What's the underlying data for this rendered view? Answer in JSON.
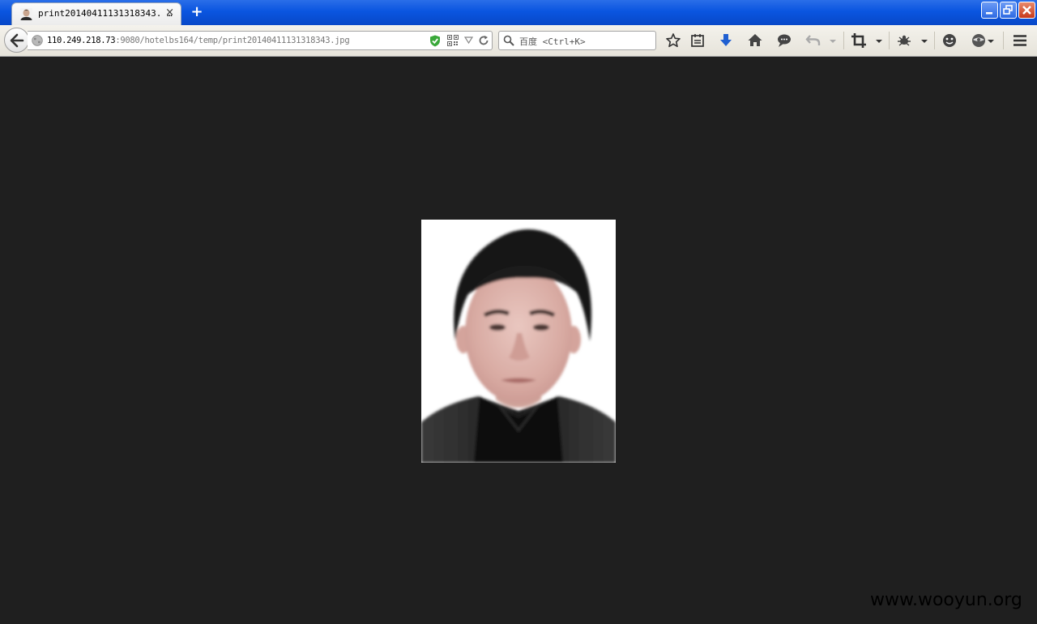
{
  "window": {
    "tab_title": "print20140411131318343. …",
    "new_tab_symbol": "+",
    "tab_close_symbol": "×"
  },
  "address": {
    "url_host": "110.249.218.73",
    "url_rest": ":9080/hotelbs164/temp/print20140411131318343.jpg"
  },
  "search": {
    "placeholder": "百度 <Ctrl+K>"
  },
  "toolbar_icons": [
    "bookmark-star-icon",
    "reading-list-icon",
    "download-icon",
    "home-icon",
    "chat-icon",
    "undo-icon",
    "crop-icon",
    "bug-icon",
    "smiley-icon",
    "addon-icon",
    "menu-icon"
  ],
  "watermark": "www.wooyun.org",
  "colors": {
    "page_background": "#1f1f1f",
    "titlebar": "#0a55e0",
    "download_arrow": "#1f5fd1",
    "shield": "#3aa83a"
  }
}
